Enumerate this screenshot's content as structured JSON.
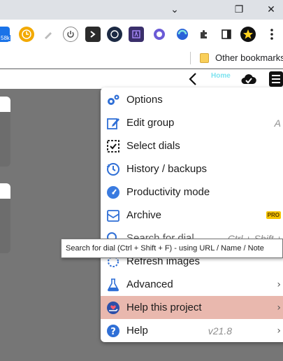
{
  "window": {
    "minimize_glyph": "⌄",
    "restore_glyph": "❐",
    "close_glyph": "✕"
  },
  "extensions": {
    "badge_text": "58k"
  },
  "bookmarks": {
    "other_label": "Other bookmarks"
  },
  "header": {
    "home_label": "Home"
  },
  "menu": {
    "items": [
      {
        "label": "Options",
        "icon": "gears-icon"
      },
      {
        "label": "Edit group",
        "icon": "edit-icon",
        "right": "A"
      },
      {
        "label": "Select dials",
        "icon": "select-icon"
      },
      {
        "label": "History / backups",
        "icon": "history-icon"
      },
      {
        "label": "Productivity mode",
        "icon": "speedometer-icon"
      },
      {
        "label": "Archive",
        "icon": "archive-icon",
        "badge": "PRO"
      },
      {
        "label": "Search for dial",
        "icon": "search-icon",
        "right": "Ctrl + Shift + F"
      },
      {
        "label": "Refresh images",
        "icon": "refresh-icon"
      },
      {
        "label": "Advanced",
        "icon": "flask-icon",
        "chevron": "›"
      },
      {
        "label": "Help this project",
        "icon": "heart-hand-icon",
        "chevron": "›"
      },
      {
        "label": "Help",
        "icon": "question-icon",
        "right": "v21.8",
        "chevron": "›"
      }
    ]
  },
  "tooltip": {
    "text": "Search for dial (Ctrl + Shift + F) - using URL / Name / Note"
  },
  "colors": {
    "highlight": "#e9b8ae",
    "page_bg": "#767676",
    "accent_blue": "#1a73e8"
  }
}
